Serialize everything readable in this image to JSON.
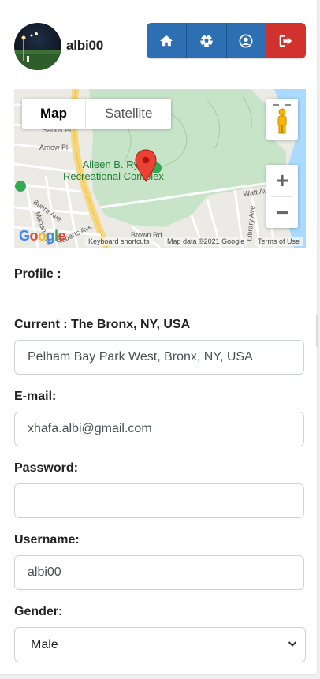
{
  "header": {
    "username": "albi00",
    "nav": [
      {
        "icon": "home-icon"
      },
      {
        "icon": "soccer-ball-icon"
      },
      {
        "icon": "user-circle-icon"
      },
      {
        "icon": "sign-out-icon"
      }
    ]
  },
  "map": {
    "tabs": [
      "Map",
      "Satellite"
    ],
    "place_label": "Aileen B. Ryan Recreational Complex",
    "place_label_line1": "Aileen B. Rya",
    "place_label_line2": "Recreational Complex",
    "streets": [
      "Sands Pl",
      "Arnow Pl",
      "Buhre Ave",
      "Mahan Ave",
      "Roberts Ave",
      "Watt Ave",
      "Library Ave",
      "Brown Rd"
    ],
    "google": "Google",
    "shortcuts": "Keyboard shortcuts",
    "map_data": "Map data ©2021 Google",
    "terms": "Terms of Use",
    "zoom_in": "+",
    "zoom_out": "−"
  },
  "profile": {
    "title": "Profile :",
    "current_label": "Current : The Bronx, NY, USA",
    "current_value": "Pelham Bay Park West, Bronx, NY, USA",
    "email_label": "E-mail:",
    "email_value": "xhafa.albi@gmail.com",
    "password_label": "Password:",
    "password_value": "",
    "username_label": "Username:",
    "username_value": "albi00",
    "gender_label": "Gender:",
    "gender_value": "Male"
  },
  "colors": {
    "primary": "#2c6fb3",
    "danger": "#d2322d",
    "park": "#c8e6c9",
    "water": "#aadaff"
  }
}
